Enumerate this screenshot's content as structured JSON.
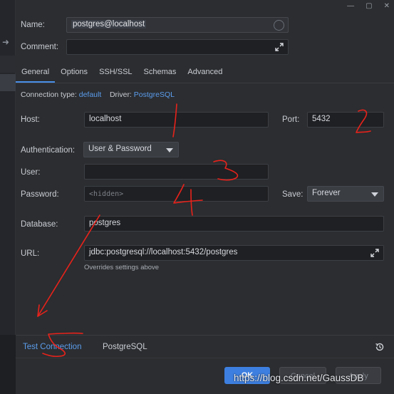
{
  "window": {
    "minimize": "—",
    "maximize": "▢",
    "close": "✕"
  },
  "name_label": "Name:",
  "name_value": "postgres@localhost",
  "comment_label": "Comment:",
  "comment_value": "",
  "tabs": [
    {
      "label": "General",
      "active": true
    },
    {
      "label": "Options",
      "active": false
    },
    {
      "label": "SSH/SSL",
      "active": false
    },
    {
      "label": "Schemas",
      "active": false
    },
    {
      "label": "Advanced",
      "active": false
    }
  ],
  "conn_info": {
    "type_label": "Connection type:",
    "type_value": "default",
    "driver_label": "Driver:",
    "driver_value": "PostgreSQL"
  },
  "host": {
    "label": "Host:",
    "value": "localhost"
  },
  "port": {
    "label": "Port:",
    "value": "5432"
  },
  "auth": {
    "label": "Authentication:",
    "value": "User & Password"
  },
  "user": {
    "label": "User:",
    "value": ""
  },
  "password": {
    "label": "Password:",
    "placeholder": "<hidden>"
  },
  "save": {
    "label": "Save:",
    "value": "Forever"
  },
  "database": {
    "label": "Database:",
    "value": "postgres"
  },
  "url": {
    "label": "URL:",
    "value": "jdbc:postgresql://localhost:5432/postgres",
    "hint": "Overrides settings above"
  },
  "bottom": {
    "test_connection": "Test Connection",
    "driver_link": "PostgreSQL"
  },
  "footer": {
    "ok": "OK",
    "cancel": "Cancel",
    "apply": "Apply",
    "watermark": "https://blog.csdn.net/GaussDB"
  },
  "annotations": {
    "color": "#e8221b",
    "marks": [
      "1",
      "2",
      "3",
      "4",
      "5"
    ]
  },
  "colors": {
    "accent": "#3d7fe0",
    "link": "#5c9ded",
    "background": "#2b2d30"
  }
}
